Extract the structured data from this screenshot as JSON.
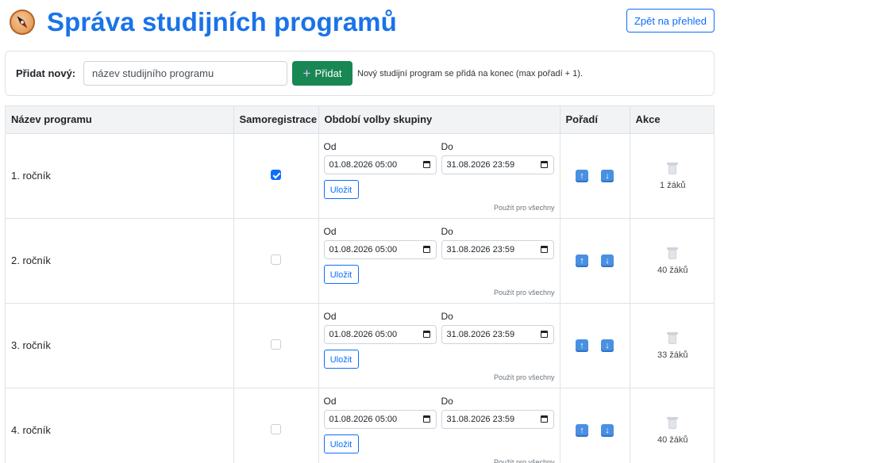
{
  "header": {
    "title": "Správa studijních programů",
    "back_label": "Zpět na přehled"
  },
  "add": {
    "label": "Přidat nový:",
    "input_value": "",
    "input_placeholder": "název studijního programu",
    "button_label": "Přidat",
    "hint": "Nový studijní program se přidá na konec (max pořadí + 1)."
  },
  "table": {
    "headers": [
      "Název programu",
      "Samoregistrace",
      "Období volby skupiny",
      "Pořadí",
      "Akce"
    ],
    "from_label": "Od",
    "to_label": "Do",
    "save_label": "Uložit",
    "apply_all_label": "Použít pro všechny",
    "rows": [
      {
        "name": "1. ročník",
        "self_registration": true,
        "from": "01.08.2026 05:00",
        "to": "31.08.2026 23:59",
        "count": "1 žáků"
      },
      {
        "name": "2. ročník",
        "self_registration": false,
        "from": "01.08.2026 05:00",
        "to": "31.08.2026 23:59",
        "count": "40 žáků"
      },
      {
        "name": "3. ročník",
        "self_registration": false,
        "from": "01.08.2026 05:00",
        "to": "31.08.2026 23:59",
        "count": "33 žáků"
      },
      {
        "name": "4. ročník",
        "self_registration": false,
        "from": "01.08.2026 05:00",
        "to": "31.08.2026 23:59",
        "count": "40 žáků"
      }
    ]
  },
  "icons": {
    "logo": "compass-icon",
    "add": "plus-icon",
    "calendar": "calendar-icon",
    "move_up": "arrow-up-icon",
    "move_down": "arrow-down-icon",
    "delete": "trash-icon"
  },
  "colors": {
    "title": "#1a73e8",
    "primary": "#0d6efd",
    "success": "#198754",
    "arrow_button": "#4a90e2"
  }
}
